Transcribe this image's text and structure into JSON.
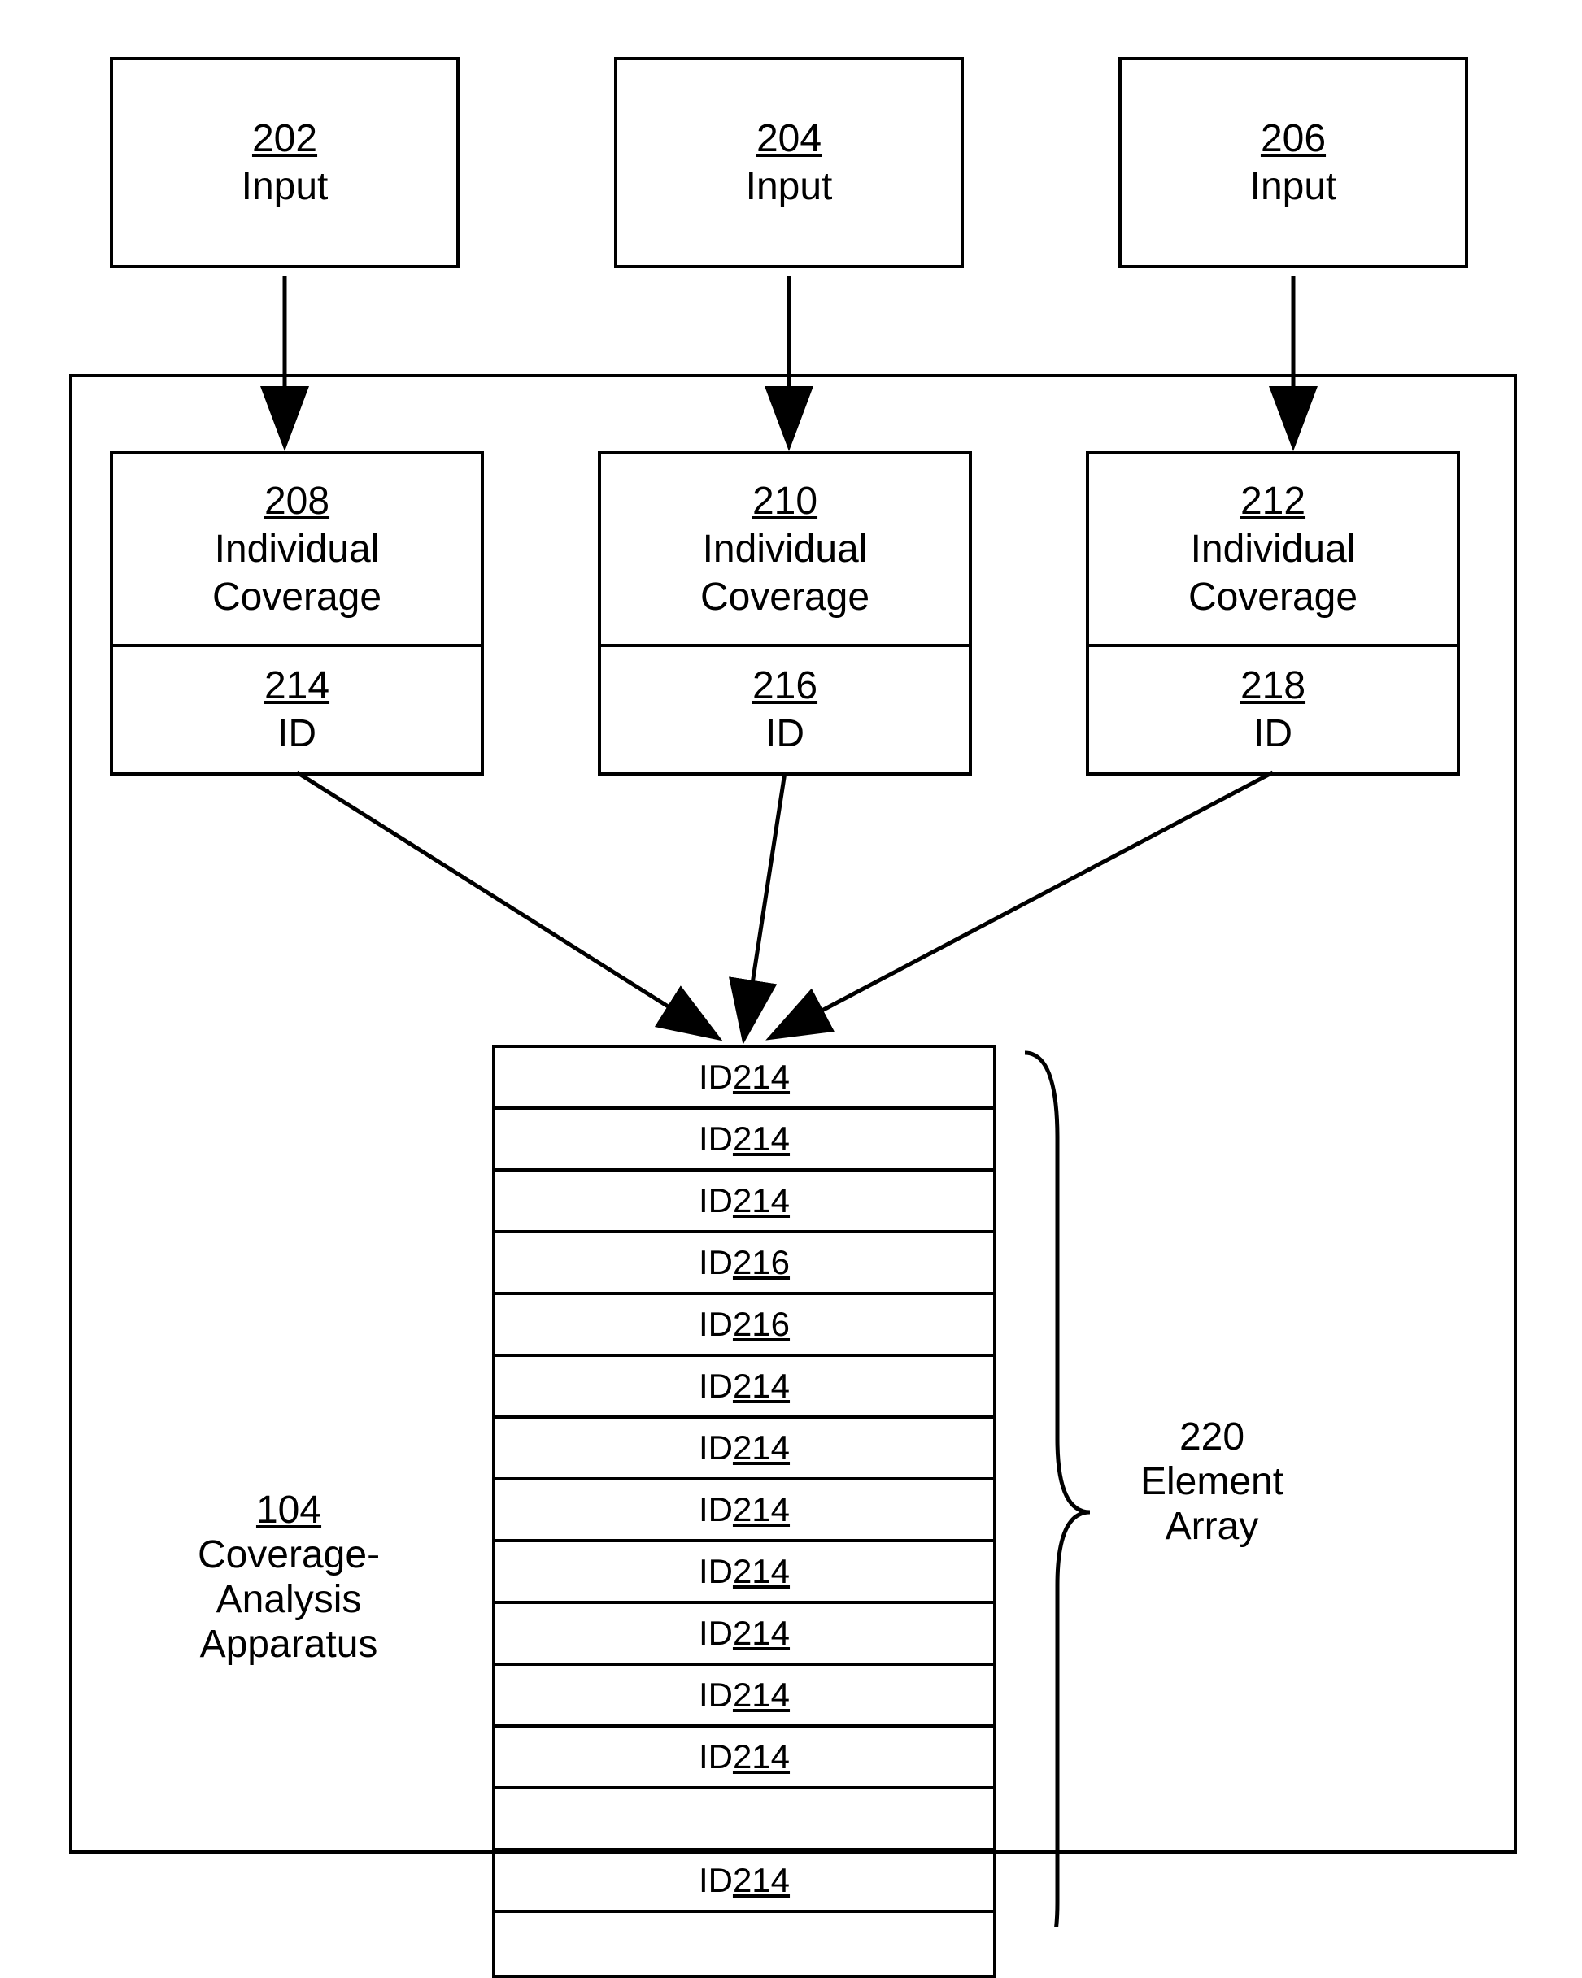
{
  "inputs": [
    {
      "num": "202",
      "label": "Input"
    },
    {
      "num": "204",
      "label": "Input"
    },
    {
      "num": "206",
      "label": "Input"
    }
  ],
  "coverages": [
    {
      "num": "208",
      "label1": "Individual",
      "label2": "Coverage",
      "id_num": "214",
      "id_label": "ID"
    },
    {
      "num": "210",
      "label1": "Individual",
      "label2": "Coverage",
      "id_num": "216",
      "id_label": "ID"
    },
    {
      "num": "212",
      "label1": "Individual",
      "label2": "Coverage",
      "id_num": "218",
      "id_label": "ID"
    }
  ],
  "array_rows": [
    {
      "prefix": "ID ",
      "num": "214"
    },
    {
      "prefix": "ID ",
      "num": "214"
    },
    {
      "prefix": "ID ",
      "num": "214"
    },
    {
      "prefix": "ID ",
      "num": "216"
    },
    {
      "prefix": "ID ",
      "num": "216"
    },
    {
      "prefix": "ID ",
      "num": "214"
    },
    {
      "prefix": "ID ",
      "num": "214"
    },
    {
      "prefix": "ID ",
      "num": "214"
    },
    {
      "prefix": "ID ",
      "num": "214"
    },
    {
      "prefix": "ID ",
      "num": "214"
    },
    {
      "prefix": "ID ",
      "num": "214"
    },
    {
      "prefix": "ID ",
      "num": "214"
    },
    {
      "prefix": "",
      "num": ""
    },
    {
      "prefix": "ID ",
      "num": "214"
    },
    {
      "prefix": "",
      "num": ""
    }
  ],
  "array_label": {
    "num": "220",
    "line1": "Element",
    "line2": "Array"
  },
  "app_label": {
    "num": "104",
    "line1": "Coverage-",
    "line2": "Analysis",
    "line3": "Apparatus"
  }
}
